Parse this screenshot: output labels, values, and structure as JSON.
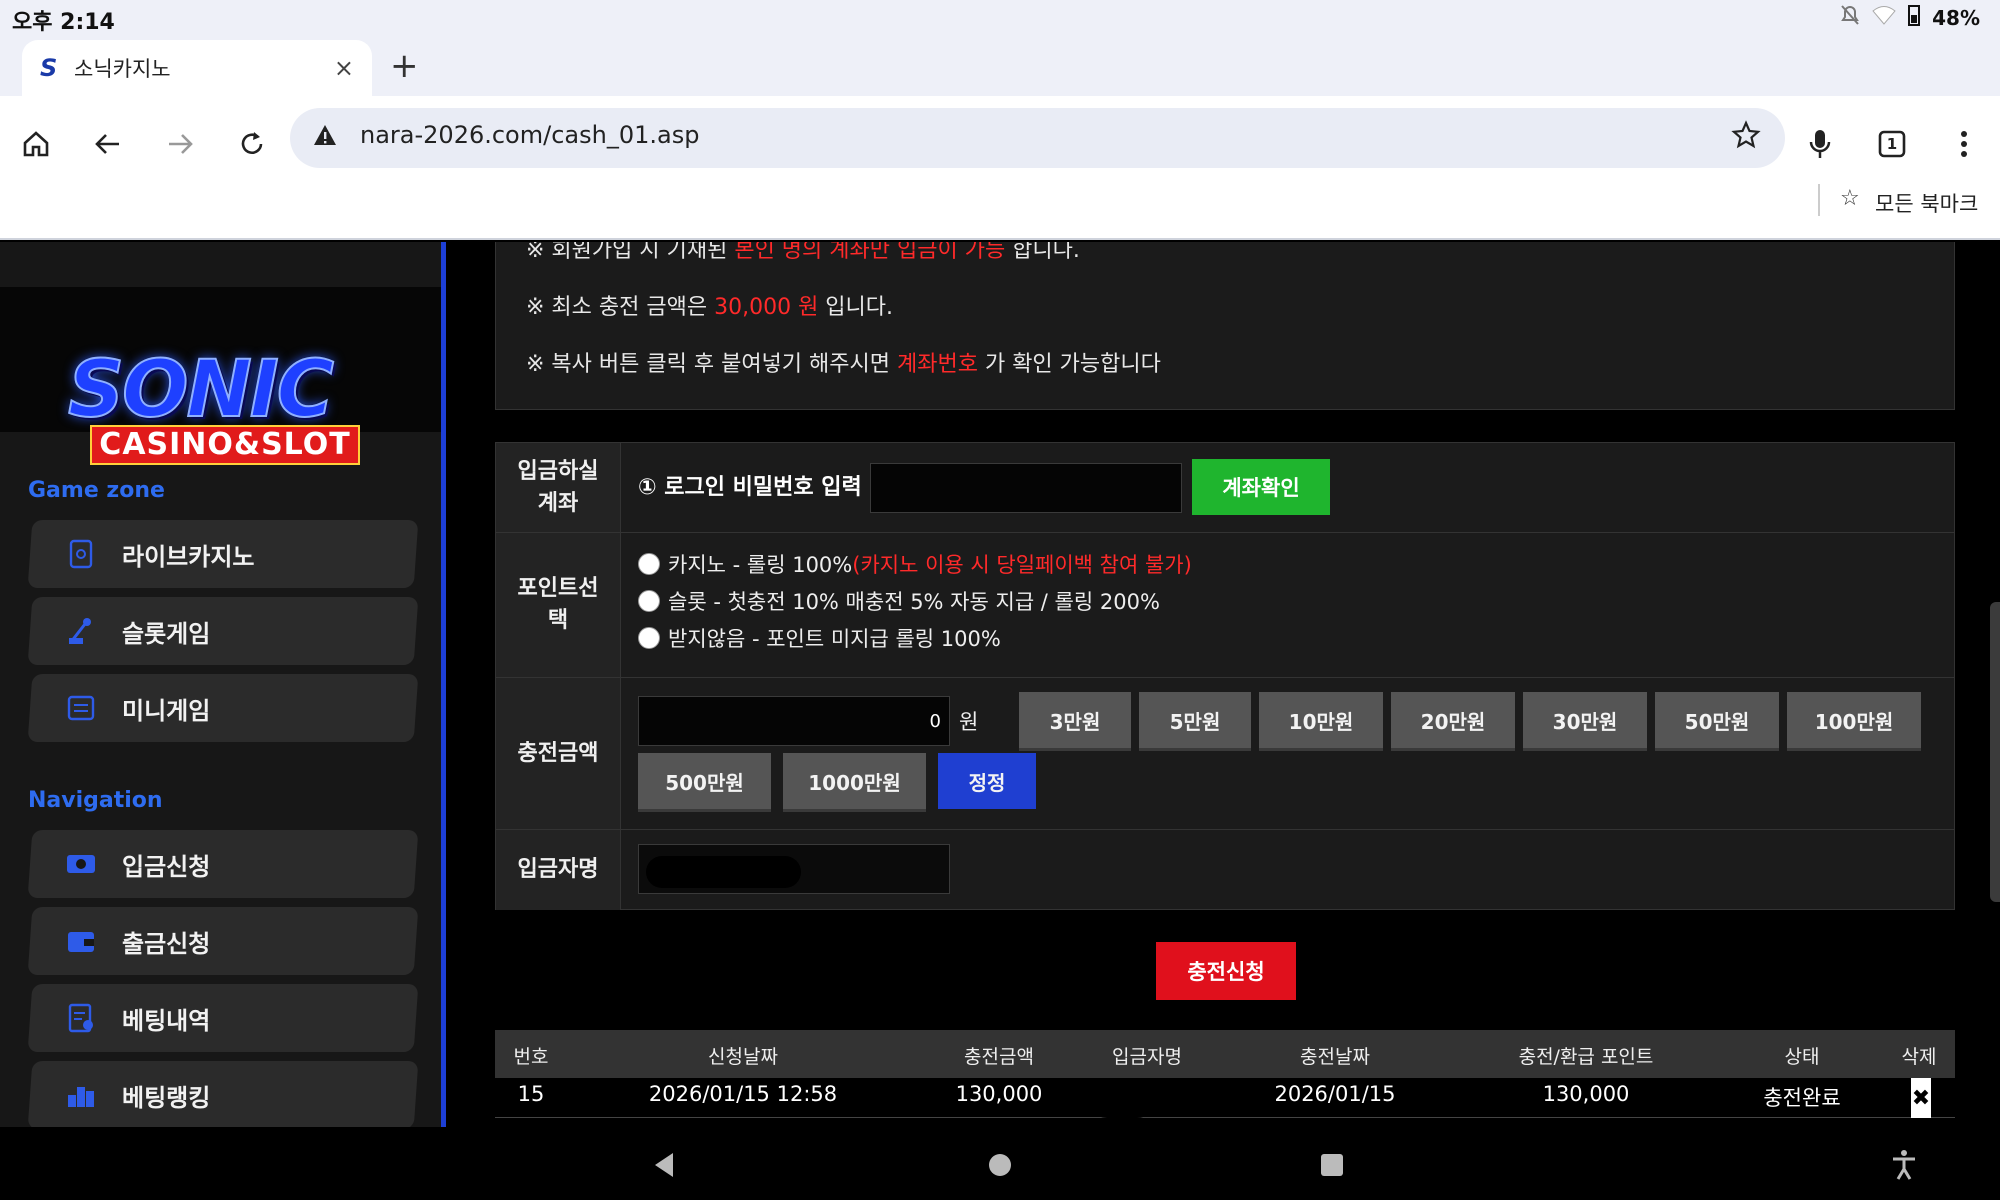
{
  "status": {
    "time": "오후 2:14",
    "battery": "48%"
  },
  "browser": {
    "tab_title": "소닉카지노",
    "tab_close": "×",
    "new_tab": "+",
    "url": "nara-2026.com/cash_01.asp",
    "tab_count": "1",
    "bookmark_label": "모든 북마크"
  },
  "sidebar": {
    "logo_top": "SONIC",
    "logo_bottom": "CASINO&SLOT",
    "game_zone_title": "Game zone",
    "game_items": [
      {
        "label": "라이브카지노",
        "icon": "card-icon"
      },
      {
        "label": "슬롯게임",
        "icon": "lever-icon"
      },
      {
        "label": "미니게임",
        "icon": "list-box-icon"
      }
    ],
    "nav_title": "Navigation",
    "nav_items": [
      {
        "label": "입금신청",
        "icon": "money-icon"
      },
      {
        "label": "출금신청",
        "icon": "wallet-icon"
      },
      {
        "label": "베팅내역",
        "icon": "history-icon"
      },
      {
        "label": "베팅랭킹",
        "icon": "ranking-icon"
      }
    ]
  },
  "notice": {
    "line1_a": "※ 회원가입 시 기재된 ",
    "line1_red": "본인 명의 계좌만 입금이 가능",
    "line1_b": " 합니다.",
    "line2_a": "※ 최소 충전 금액은 ",
    "line2_red": "30,000 원",
    "line2_b": " 입니다.",
    "line3_a": "※ 복사 버튼 클릭 후 붙여넣기 해주시면 ",
    "line3_red": "계좌번호",
    "line3_b": " 가 확인 가능합니다"
  },
  "form": {
    "account_label": "입금하실\n계좌",
    "password_prompt": "① 로그인 비밀번호 입력",
    "password_value": "",
    "confirm_button": "계좌확인",
    "point_label": "포인트선\n택",
    "point_options": [
      {
        "text": "카지노 - 롤링 100% ",
        "note": "(카지노 이용 시 당일페이백 참여 불가)"
      },
      {
        "text": "슬롯 - 첫충전 10% 매충전 5% 자동 지급 / 롤링 200%",
        "note": ""
      },
      {
        "text": "받지않음 - 포인트 미지급 롤링 100%",
        "note": ""
      }
    ],
    "amount_label": "충전금액",
    "amount_value": "0",
    "amount_unit": "원",
    "amount_buttons": [
      "3만원",
      "5만원",
      "10만원",
      "20만원",
      "30만원",
      "50만원",
      "100만원",
      "500만원",
      "1000만원"
    ],
    "reset_button": "정정",
    "depositor_label": "입금자명",
    "submit_button": "충전신청"
  },
  "table": {
    "headers": [
      "번호",
      "신청날짜",
      "충전금액",
      "입금자명",
      "충전날짜",
      "충전/환급 포인트",
      "상태",
      "삭제"
    ],
    "rows": [
      {
        "no": "15",
        "request_date": "2026/01/15 12:58",
        "amount": "130,000",
        "depositor": "",
        "charge_date": "2026/01/15",
        "points": "130,000",
        "status": "충전완료",
        "delete": "✖"
      }
    ]
  },
  "colors": {
    "accent_blue": "#1f3fd1",
    "green": "#1fb52e",
    "red": "#e0101c",
    "sidebar_border": "#1d3fd6"
  }
}
